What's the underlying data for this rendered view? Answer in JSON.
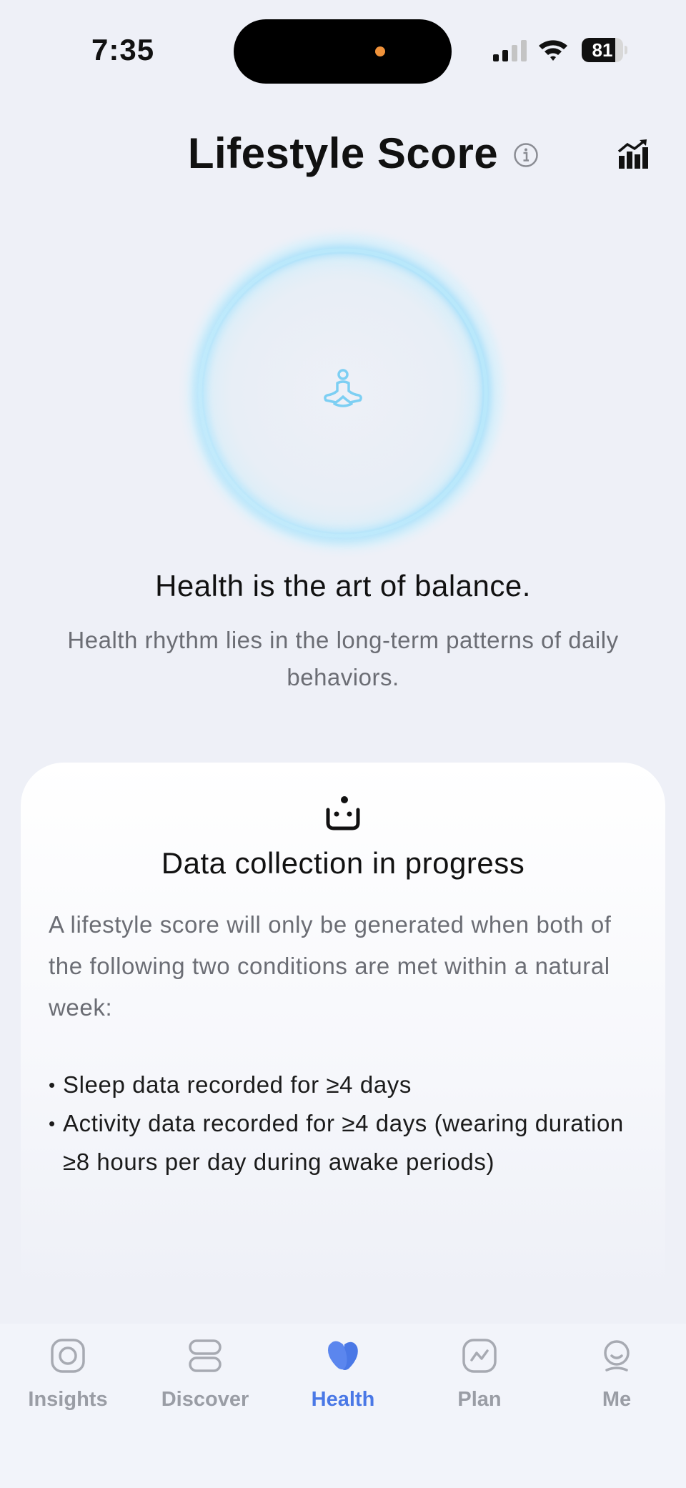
{
  "status_bar": {
    "time": "7:35",
    "battery_level": "81",
    "battery_fraction": 0.81,
    "icons": [
      "cellular-signal-icon",
      "wifi-icon",
      "battery-icon"
    ]
  },
  "header": {
    "title": "Lifestyle Score",
    "info_icon": "info-icon",
    "trend_icon": "trend-chart-icon"
  },
  "hero": {
    "icon": "meditation-icon",
    "title": "Health is the art of balance.",
    "subtitle": "Health rhythm lies in the long-term patterns of daily behaviors."
  },
  "card": {
    "icon": "collection-icon",
    "title": "Data collection in progress",
    "description": "A lifestyle score will only be generated when both of the following two conditions are met within a natural week:",
    "conditions": [
      "Sleep data recorded for ≥4 days",
      "Activity data recorded for ≥4 days (wearing duration ≥8 hours per day during awake periods)"
    ]
  },
  "tab_bar": {
    "active": "Health",
    "tabs": [
      {
        "label": "Insights",
        "icon": "insights-icon"
      },
      {
        "label": "Discover",
        "icon": "discover-icon"
      },
      {
        "label": "Health",
        "icon": "health-icon"
      },
      {
        "label": "Plan",
        "icon": "plan-icon"
      },
      {
        "label": "Me",
        "icon": "me-icon"
      }
    ]
  },
  "colors": {
    "background": "#eef0f7",
    "accent": "#4a78e6",
    "ring": "#8fd6f7",
    "muted_text": "#6b6d74",
    "inactive_tab": "#9a9da5"
  }
}
